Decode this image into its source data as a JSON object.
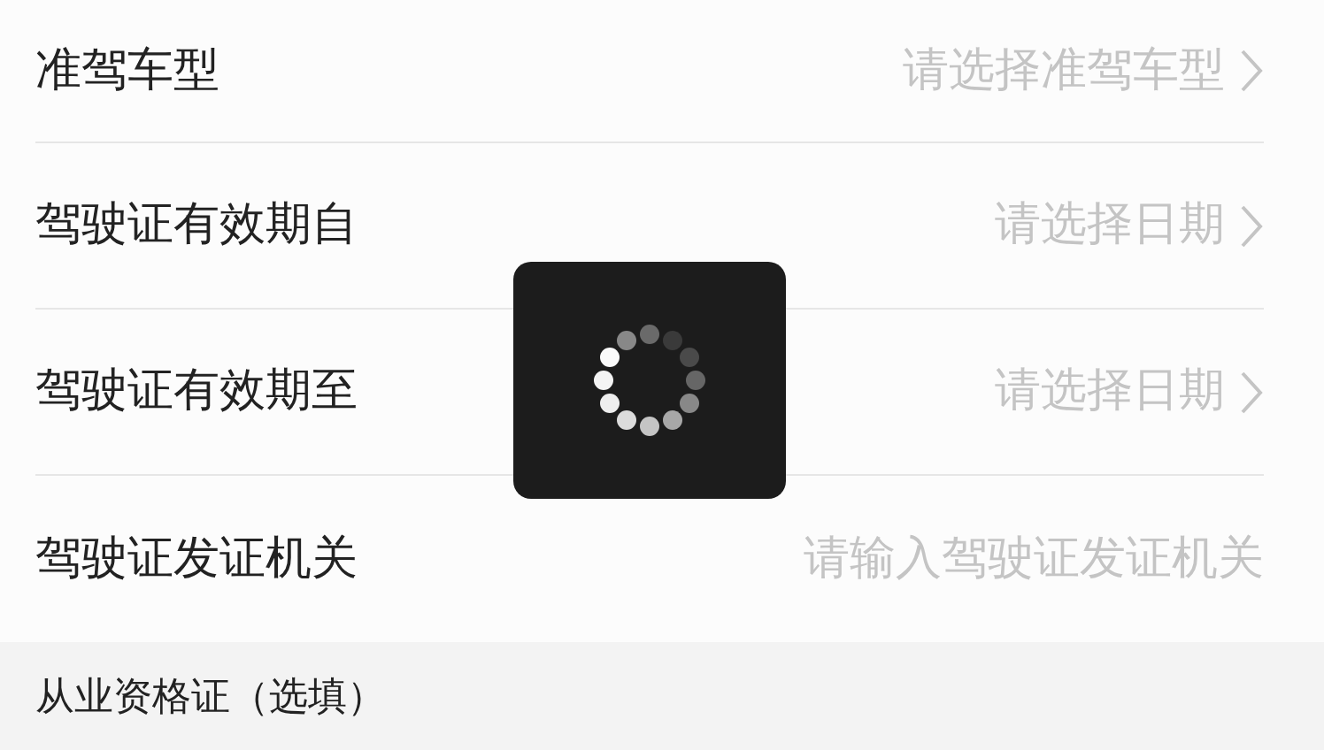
{
  "rows": [
    {
      "kind": "select",
      "label": "准驾车型",
      "placeholder": "请选择准驾车型"
    },
    {
      "kind": "select",
      "label": "驾驶证有效期自",
      "placeholder": "请选择日期"
    },
    {
      "kind": "select",
      "label": "驾驶证有效期至",
      "placeholder": "请选择日期"
    },
    {
      "kind": "input",
      "label": "驾驶证发证机关",
      "placeholder": "请输入驾驶证发证机关"
    }
  ],
  "section": {
    "title": "从业资格证（选填）"
  },
  "loading_toast": {
    "visible": true
  }
}
